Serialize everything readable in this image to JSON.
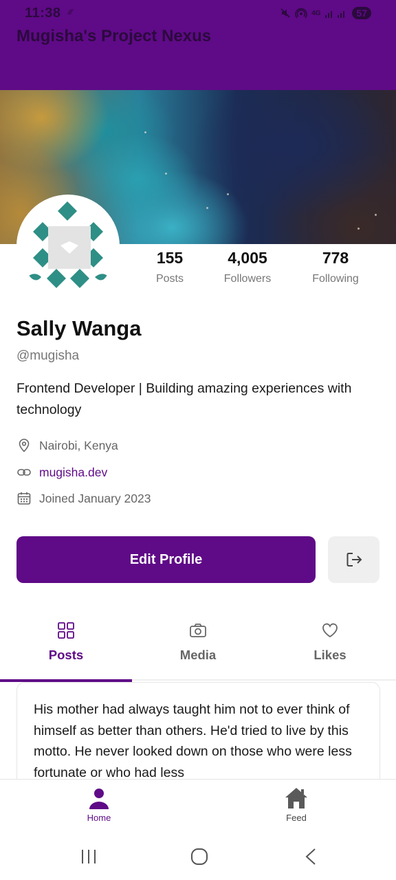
{
  "status_bar": {
    "time": "11:38",
    "net_indicator": "∕∕∕",
    "signal_text": "4G",
    "battery": "57",
    "icons": [
      "mute-icon",
      "hotspot-icon",
      "signal-icon",
      "battery-icon"
    ]
  },
  "app": {
    "title": "Mugisha's Project Nexus",
    "accent_color": "#5f0a87"
  },
  "profile": {
    "name": "Sally Wanga",
    "handle": "@mugisha",
    "bio": "Frontend Developer | Building amazing experiences with technology",
    "location": "Nairobi, Kenya",
    "website": "mugisha.dev",
    "joined": "Joined January 2023",
    "stats": [
      {
        "value": "155",
        "label": "Posts"
      },
      {
        "value": "4,005",
        "label": "Followers"
      },
      {
        "value": "778",
        "label": "Following"
      }
    ]
  },
  "actions": {
    "edit_profile_label": "Edit Profile",
    "logout_icon": "logout-icon"
  },
  "tabs": [
    {
      "label": "Posts",
      "icon": "grid-icon",
      "active": true
    },
    {
      "label": "Media",
      "icon": "camera-icon",
      "active": false
    },
    {
      "label": "Likes",
      "icon": "heart-icon",
      "active": false
    }
  ],
  "post": {
    "text": "His mother had always taught him not to ever think of himself as better than others. He'd tried to live by this motto. He never looked down on those who were less fortunate or who had less"
  },
  "bottom_nav": [
    {
      "label": "Home",
      "icon": "person-icon",
      "active": true
    },
    {
      "label": "Feed",
      "icon": "house-icon",
      "active": false
    }
  ]
}
